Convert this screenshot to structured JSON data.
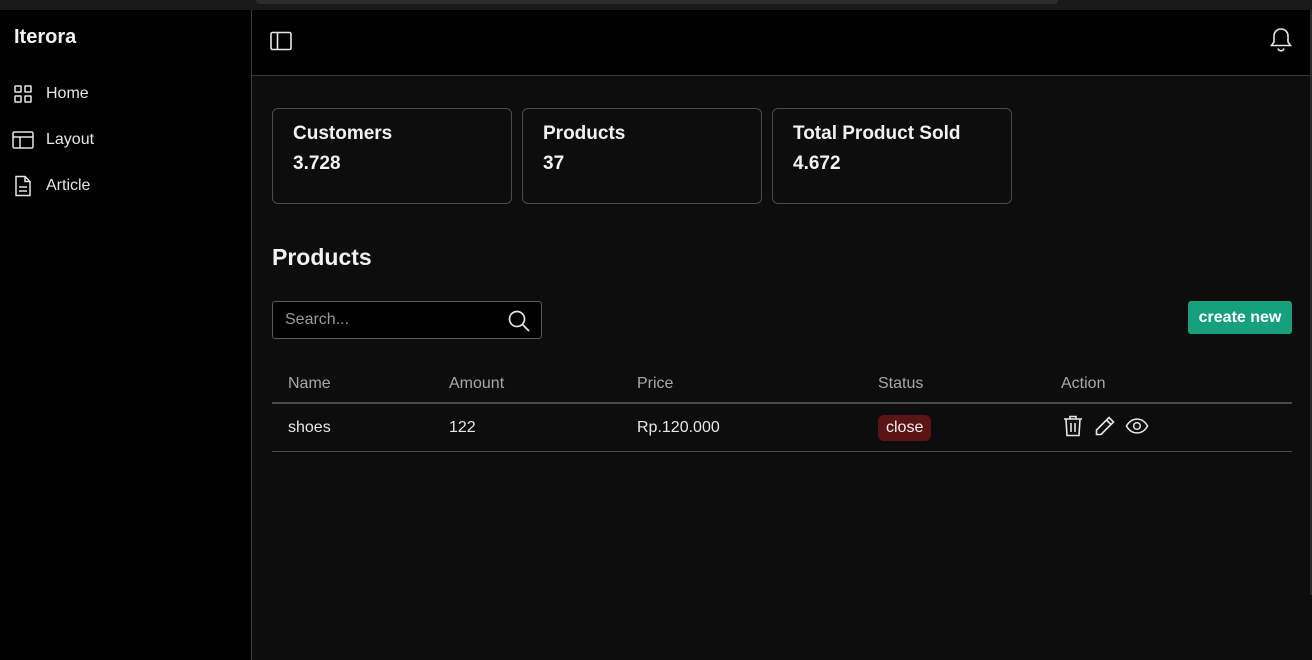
{
  "app": {
    "brand": "Iterora"
  },
  "sidebar": {
    "items": [
      {
        "label": "Home",
        "icon": "grid-icon"
      },
      {
        "label": "Layout",
        "icon": "layout-icon"
      },
      {
        "label": "Article",
        "icon": "document-icon"
      }
    ]
  },
  "header": {
    "toggle_icon": "sidebar-toggle-icon",
    "notification_icon": "bell-icon"
  },
  "stats": [
    {
      "title": "Customers",
      "value": "3.728"
    },
    {
      "title": "Products",
      "value": "37"
    },
    {
      "title": "Total Product Sold",
      "value": "4.672"
    }
  ],
  "products": {
    "title": "Products",
    "search": {
      "placeholder": "Search...",
      "value": ""
    },
    "create_label": "create new",
    "columns": [
      "Name",
      "Amount",
      "Price",
      "Status",
      "Action"
    ],
    "rows": [
      {
        "name": "shoes",
        "amount": "122",
        "price": "Rp.120.000",
        "status": "close",
        "actions": [
          "trash-icon",
          "pencil-icon",
          "eye-icon"
        ]
      }
    ]
  },
  "colors": {
    "accent": "#16a07b",
    "status_close_bg": "#5a1414",
    "background": "#0d0d0d",
    "sidebar": "#000000"
  }
}
